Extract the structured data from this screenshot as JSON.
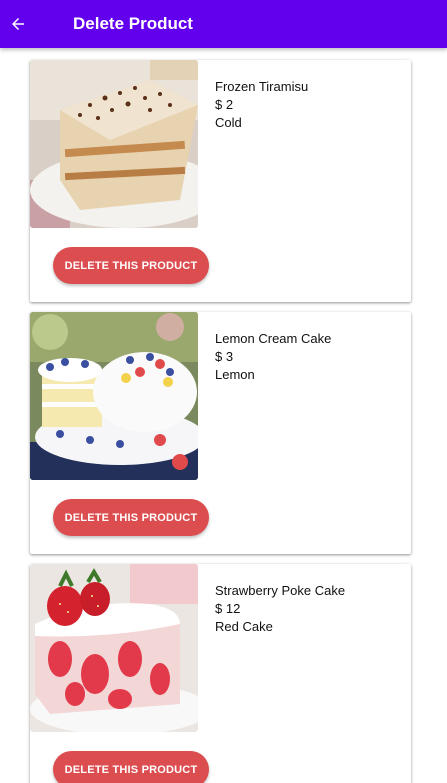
{
  "appbar": {
    "title": "Delete Product",
    "back_icon": "arrow-left-icon",
    "color": "#6200ee"
  },
  "products": [
    {
      "name": "Frozen Tiramisu",
      "price": "$ 2",
      "category": "Cold",
      "image": "tiramisu-image",
      "delete_label": "DELETE THIS PRODUCT"
    },
    {
      "name": "Lemon Cream Cake",
      "price": "$ 3",
      "category": "Lemon",
      "image": "lemon-cake-image",
      "delete_label": "DELETE THIS PRODUCT"
    },
    {
      "name": "Strawberry Poke Cake",
      "price": "$ 12",
      "category": "Red Cake",
      "image": "strawberry-cake-image",
      "delete_label": "DELETE THIS PRODUCT"
    }
  ],
  "button_color": "#dc4d50"
}
